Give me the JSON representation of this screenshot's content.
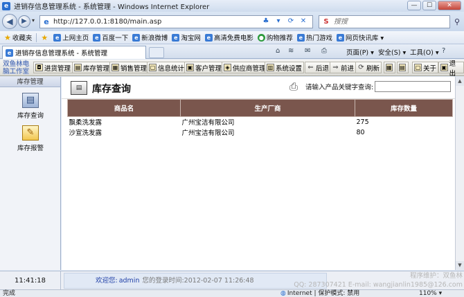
{
  "window": {
    "title": "进销存信息管理系统 - 系统管理 - Windows Internet Explorer",
    "min": "—",
    "max": "☐",
    "close": "✕"
  },
  "address": {
    "url": "http://127.0.0.1:8180/main.asp",
    "search_placeholder": "搜搜"
  },
  "favorites": {
    "label": "收藏夹",
    "items": [
      "上网主页",
      "百度一下",
      "新浪微博",
      "淘宝网",
      "高清免费电影",
      "购物推荐",
      "热门游戏",
      "网页快讯库 ▾"
    ]
  },
  "tabbar": {
    "tab_label": "进销存信息管理系统 - 系统管理",
    "page_menu": "页面(P) ▾",
    "safety_menu": "安全(S) ▾",
    "tools_menu": "工具(O) ▾",
    "help_icon": "?"
  },
  "app": {
    "logo_line1": "双鱼林电",
    "logo_line2": "脑工作室",
    "toolbar": {
      "purchase": "进货管理",
      "inventory": "库存管理",
      "sales": "销售管理",
      "stats": "信息统计",
      "customers": "客户管理",
      "suppliers": "供应商管理",
      "settings": "系统设置",
      "back": "后退",
      "forward": "前进",
      "refresh": "刷新",
      "about": "关于",
      "exit": "退出"
    },
    "sidebar": {
      "title": "库存管理",
      "items": [
        {
          "label": "库存查询"
        },
        {
          "label": "库存报警"
        }
      ]
    },
    "page": {
      "title": "库存查询",
      "search_label": "请输入产品关键字查询:",
      "search_value": ""
    },
    "table": {
      "columns": [
        "商品名",
        "生产厂商",
        "库存数量"
      ],
      "rows": [
        [
          "飘柔洗发露",
          "广州宝洁有限公司",
          "275"
        ],
        [
          "沙宣洗发露",
          "广州宝洁有限公司",
          "80"
        ]
      ]
    },
    "footer": {
      "clock": "11:41:18",
      "welcome_label": "欢迎您:",
      "user": "admin",
      "last_login": "您的登录时间:2012-02-07 11:26:48",
      "credit_line1": "程序维护：双鱼林",
      "credit_line2": "QQ: 287307421 E-mail: wangjianlin1985@126.com"
    }
  },
  "statusbar": {
    "status": "完成",
    "zone": "Internet | 保护模式: 禁用",
    "zoom": "110% ▾"
  }
}
